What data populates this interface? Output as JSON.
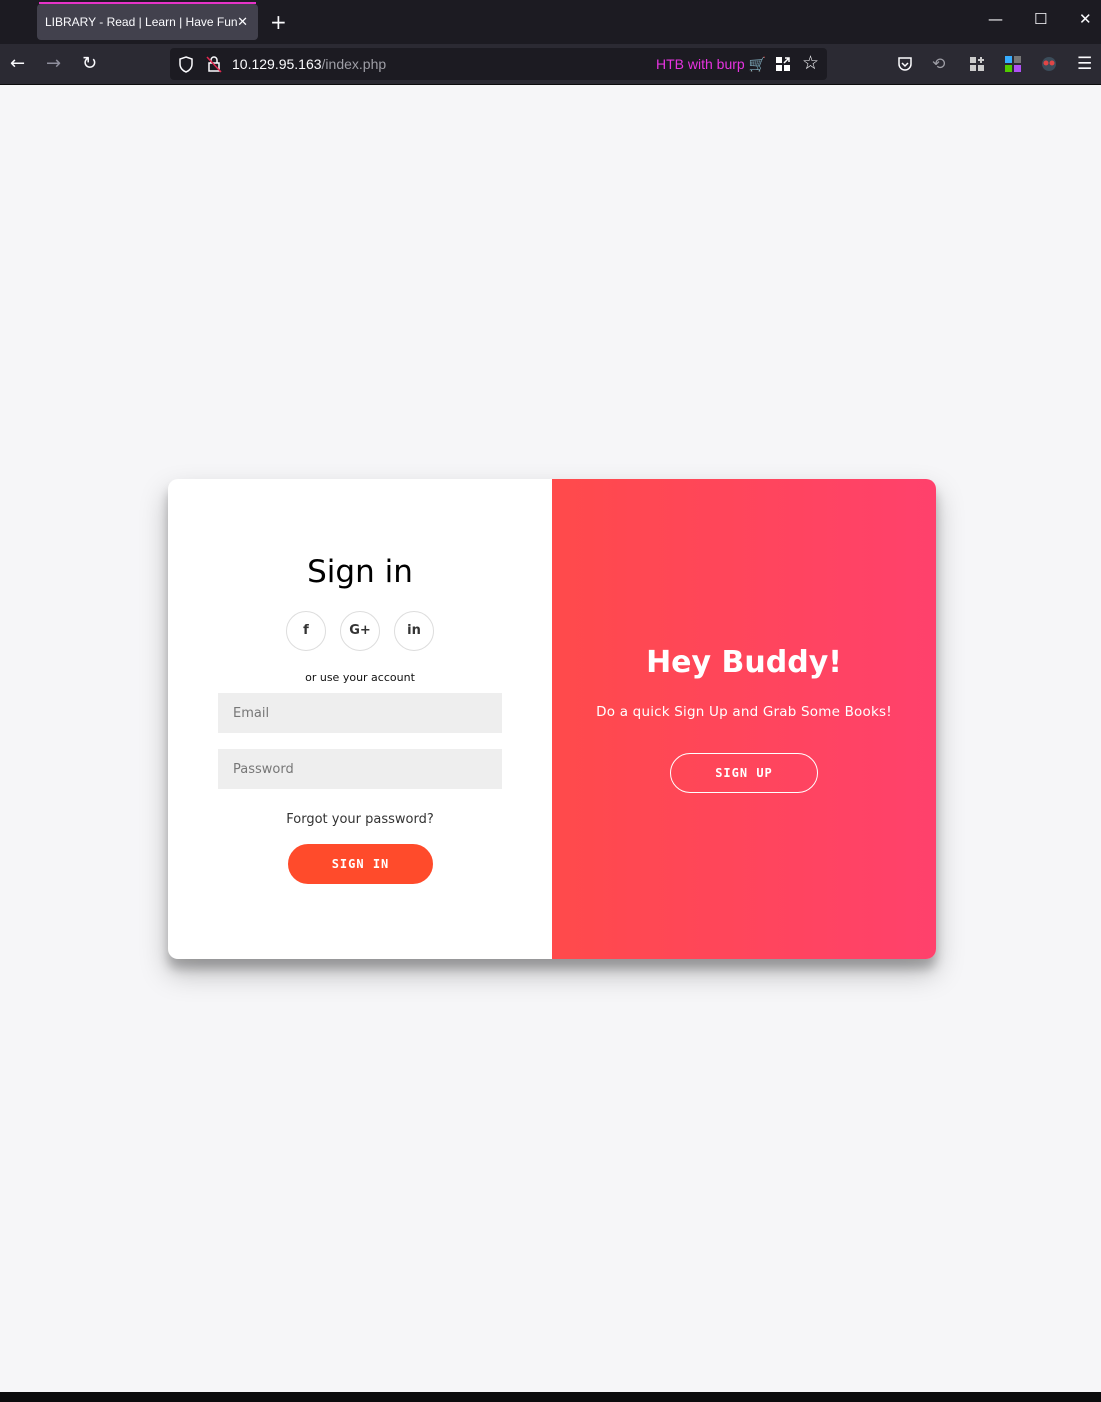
{
  "browser": {
    "tab_title": "LIBRARY - Read | Learn | Have Fun",
    "url_host": "10.129.95.163",
    "url_path": "/index.php",
    "container_label": "HTB with burp",
    "accent": "#e633c8"
  },
  "signin": {
    "title": "Sign in",
    "socials": [
      "f",
      "G+",
      "in"
    ],
    "or_text": "or use your account",
    "email_placeholder": "Email",
    "password_placeholder": "Password",
    "forgot": "Forgot your password?",
    "button": "SIGN IN",
    "button_color": "#ff4b2b"
  },
  "overlay": {
    "title": "Hey Buddy!",
    "text": "Do a quick Sign Up and Grab Some Books!",
    "button": "SIGN UP",
    "gradient": [
      "#ff4a4b",
      "#ff416c"
    ]
  }
}
